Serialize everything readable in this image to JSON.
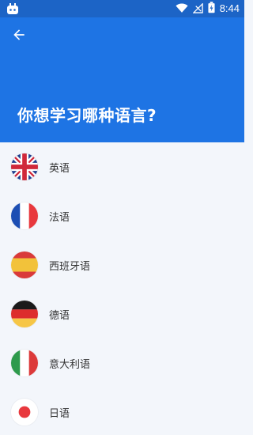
{
  "status_bar": {
    "time": "8:44",
    "icons": [
      "notification-app-icon",
      "wifi-icon",
      "signal-icon",
      "battery-charging-icon"
    ]
  },
  "header": {
    "back_icon": "arrow-left-icon",
    "title": "你想学习哪种语言?"
  },
  "languages": [
    {
      "label": "英语",
      "flag": "uk-flag-icon"
    },
    {
      "label": "法语",
      "flag": "france-flag-icon"
    },
    {
      "label": "西班牙语",
      "flag": "spain-flag-icon"
    },
    {
      "label": "德语",
      "flag": "germany-flag-icon"
    },
    {
      "label": "意大利语",
      "flag": "italy-flag-icon"
    },
    {
      "label": "日语",
      "flag": "japan-flag-icon"
    }
  ],
  "colors": {
    "status_bar": "#1c64c6",
    "header": "#1e74e4",
    "list_background": "#f3f6fb"
  }
}
